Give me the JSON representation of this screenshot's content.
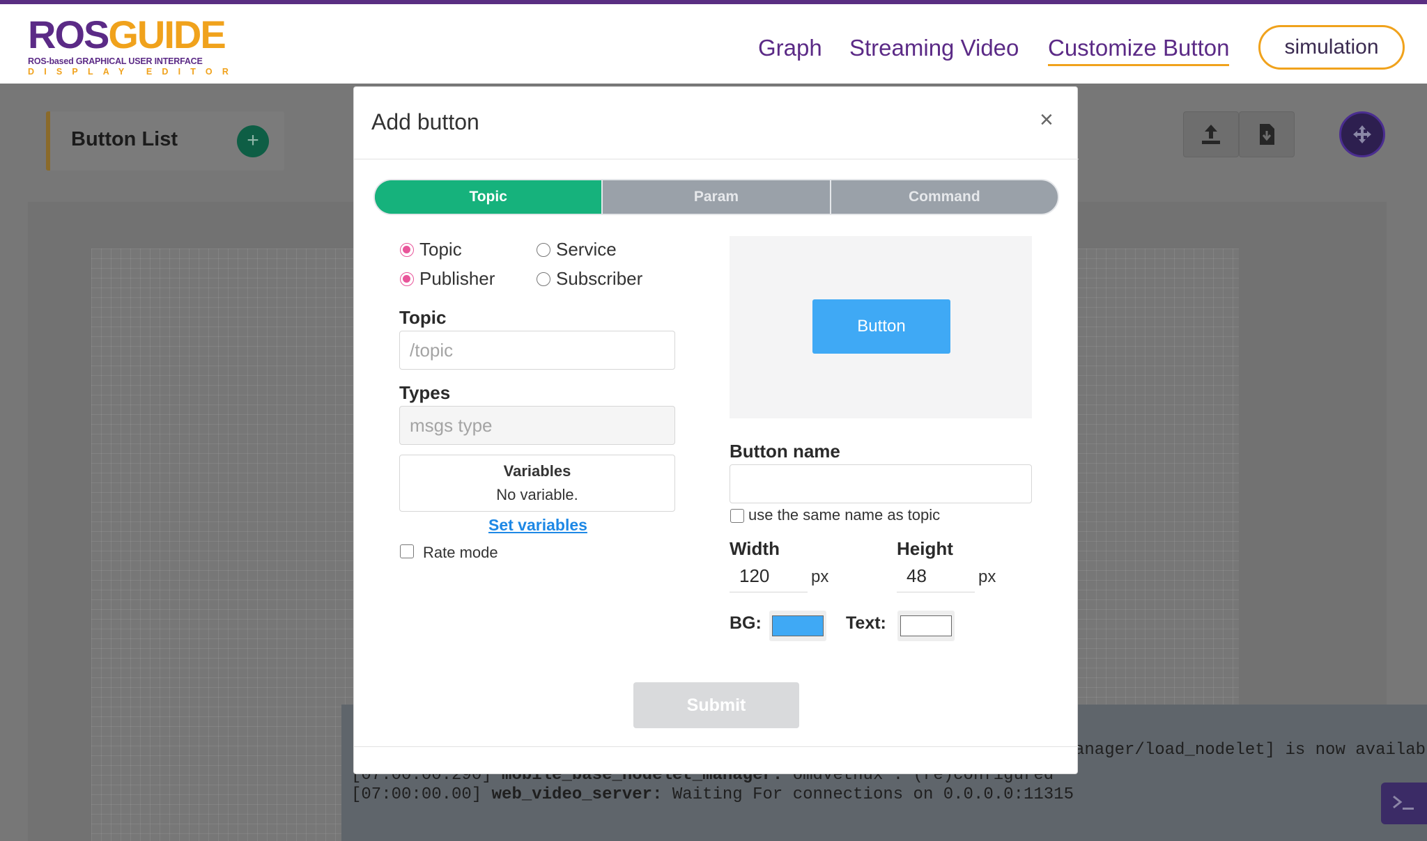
{
  "logo": {
    "ros": "ROS",
    "guide": "GUIDE",
    "sub1": "ROS-based GRAPHICAL USER INTERFACE",
    "sub2": "DISPLAY EDITOR"
  },
  "nav": {
    "graph": "Graph",
    "streaming": "Streaming Video",
    "customize": "Customize Button",
    "simulation": "simulation"
  },
  "workspace": {
    "button_list_label": "Button List",
    "add_symbol": "+"
  },
  "console": {
    "line1_prefix": "[07:00:00.290]",
    "line1_node": "mobile_base_nodelet_manager:",
    "line1_msg": "omdvetnux : (re)configured",
    "line_avail": "anager/load_nodelet] is now available",
    "line2_prefix": "[07:00:00.00]",
    "line2_node": "web_video_server:",
    "line2_msg": "Waiting For connections on 0.0.0.0:11315"
  },
  "modal": {
    "title": "Add button",
    "close": "×",
    "tabs": [
      {
        "label": "Topic",
        "active": true
      },
      {
        "label": "Param",
        "active": false
      },
      {
        "label": "Command",
        "active": false
      }
    ],
    "radios": {
      "topic": "Topic",
      "service": "Service",
      "publisher": "Publisher",
      "subscriber": "Subscriber"
    },
    "topic_label": "Topic",
    "topic_placeholder": "/topic",
    "types_label": "Types",
    "types_placeholder": "msgs type",
    "variables_title": "Variables",
    "variables_empty": "No variable.",
    "set_variables": "Set variables",
    "rate_mode": "Rate mode",
    "preview_button": "Button",
    "button_name_label": "Button name",
    "button_name_value": "",
    "same_name_label": "use the same name as topic",
    "width_label": "Width",
    "width_value": "120",
    "height_label": "Height",
    "height_value": "48",
    "unit": "px",
    "bg_label": "BG:",
    "text_label": "Text:",
    "submit": "Submit"
  },
  "colors": {
    "brand_purple": "#5b2a86",
    "brand_orange": "#f0a21c",
    "tab_active": "#16b27c",
    "preview_bg_color": "#3fa9f5",
    "preview_text_color": "#ffffff",
    "radio_checked": "#e8559a"
  }
}
